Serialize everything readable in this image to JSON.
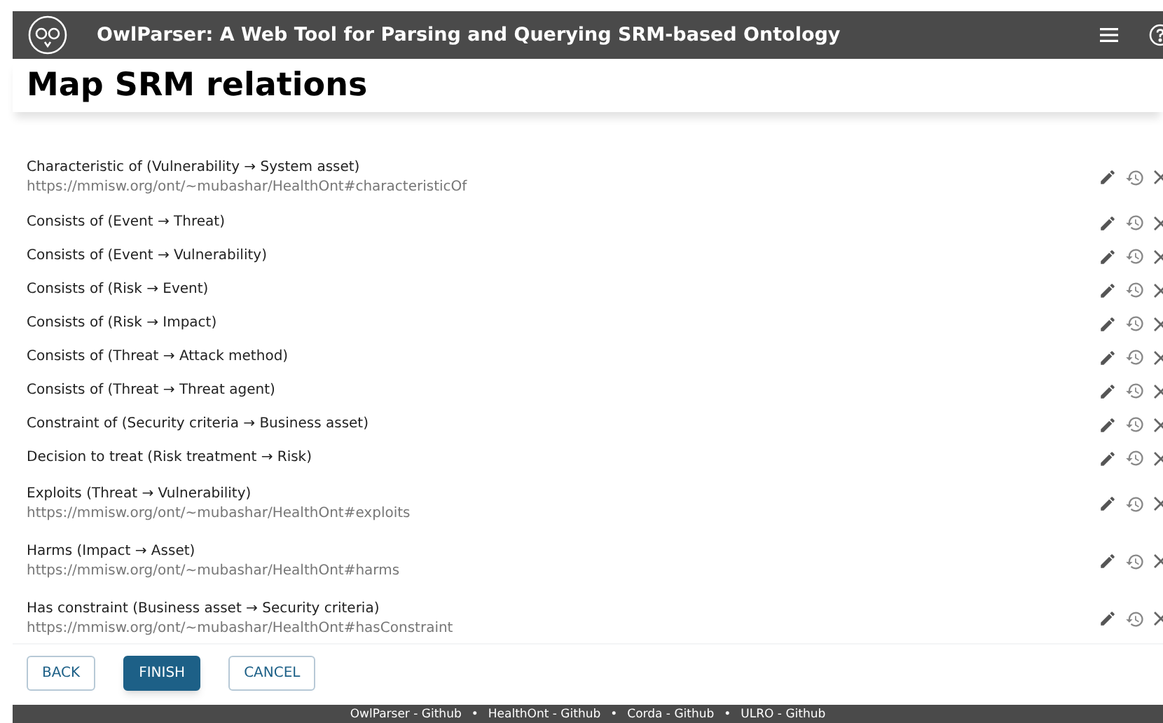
{
  "app_bar": {
    "title": "OwlParser: A Web Tool for Parsing and Querying SRM-based Ontology"
  },
  "page_title": "Map SRM relations",
  "relations": [
    {
      "label": "Characteristic of (Vulnerability → System asset)",
      "uri": "https://mmisw.org/ont/~mubashar/HealthOnt#characteristicOf"
    },
    {
      "label": "Consists of (Event → Threat)"
    },
    {
      "label": "Consists of (Event → Vulnerability)"
    },
    {
      "label": "Consists of (Risk → Event)"
    },
    {
      "label": "Consists of (Risk → Impact)"
    },
    {
      "label": "Consists of (Threat → Attack method)"
    },
    {
      "label": "Consists of (Threat → Threat agent)"
    },
    {
      "label": "Constraint of (Security criteria → Business asset)"
    },
    {
      "label": "Decision to treat (Risk treatment → Risk)"
    },
    {
      "label": "Exploits (Threat → Vulnerability)",
      "uri": "https://mmisw.org/ont/~mubashar/HealthOnt#exploits"
    },
    {
      "label": "Harms (Impact → Asset)",
      "uri": "https://mmisw.org/ont/~mubashar/HealthOnt#harms"
    },
    {
      "label": "Has constraint (Business asset → Security criteria)",
      "uri": "https://mmisw.org/ont/~mubashar/HealthOnt#hasConstraint"
    }
  ],
  "buttons": [
    {
      "label": "BACK",
      "kind": "outlined"
    },
    {
      "label": "FINISH",
      "kind": "primary"
    },
    {
      "label": "CANCEL",
      "kind": "outlined"
    }
  ],
  "footer": [
    "OwlParser - Github",
    "HealthOnt - Github",
    "Corda - Github",
    "ULRO - Github"
  ],
  "footer_separator": "•"
}
